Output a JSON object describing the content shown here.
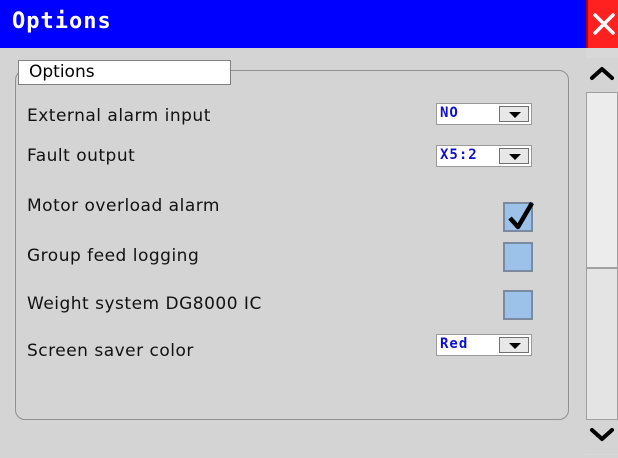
{
  "window": {
    "title": "Options"
  },
  "group": {
    "title": "Options"
  },
  "rows": [
    {
      "label": "External alarm input",
      "type": "dropdown",
      "value": "NO"
    },
    {
      "label": "Fault output",
      "type": "dropdown",
      "value": "X5:2"
    },
    {
      "label": "Motor overload alarm",
      "type": "checkbox",
      "checked": true
    },
    {
      "label": "Group feed logging",
      "type": "checkbox",
      "checked": false
    },
    {
      "label": "Weight system DG8000 IC",
      "type": "checkbox",
      "checked": false
    },
    {
      "label": "Screen saver color",
      "type": "dropdown",
      "value": "Red"
    }
  ],
  "colors": {
    "titlebar": "#0000ff",
    "close": "#ff2020",
    "dropdown_text": "#1010d0",
    "checkbox": "#9cc2ea"
  },
  "icons": {
    "close": "close-icon",
    "scroll_up": "chevron-up-icon",
    "scroll_down": "chevron-down-icon",
    "check": "checkmark-icon"
  }
}
